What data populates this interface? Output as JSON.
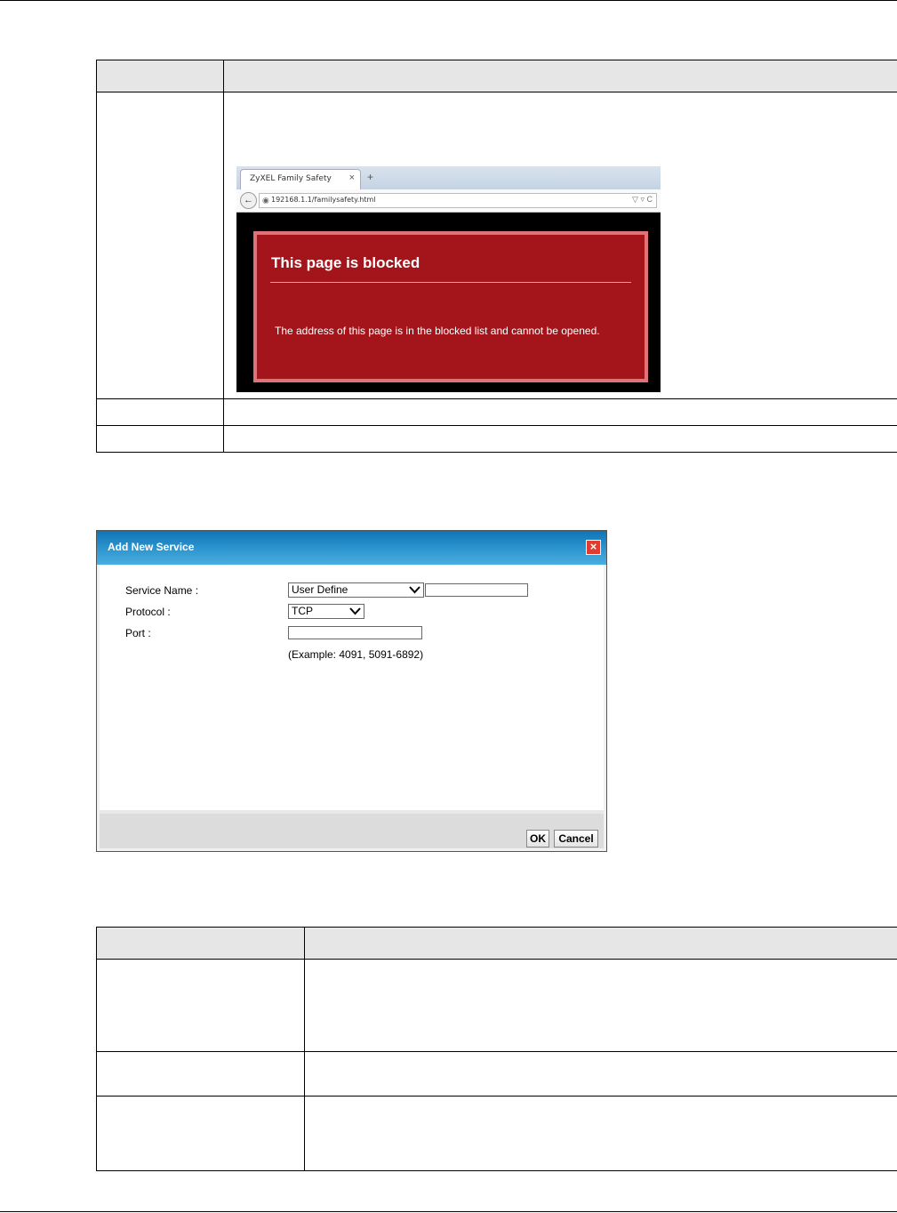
{
  "browser": {
    "tab_title": "ZyXEL Family Safety",
    "tab_close": "×",
    "new_tab": "+",
    "back_glyph": "←",
    "url": "192168.1.1/familysafety.html",
    "url_controls": "▽ ▿ C",
    "blocked_heading": "This page is blocked",
    "blocked_message": "The address of this page is in the blocked list and cannot be opened."
  },
  "dialog": {
    "title": "Add New Service",
    "close_glyph": "×",
    "service_name_label": "Service Name :",
    "service_name_select": "User Define",
    "service_name_value": "",
    "protocol_label": "Protocol :",
    "protocol_select": "TCP",
    "port_label": "Port :",
    "port_value": "",
    "port_example": "(Example: 4091, 5091-6892)",
    "ok_button": "OK",
    "cancel_button": "Cancel"
  },
  "colors": {
    "table_header_bg": "#e6e6e6",
    "blocked_page_bg": "#a3151a",
    "blocked_page_border": "#e07377",
    "dialog_titlebar": "#1f86c5",
    "dialog_close": "#e33b2e"
  }
}
